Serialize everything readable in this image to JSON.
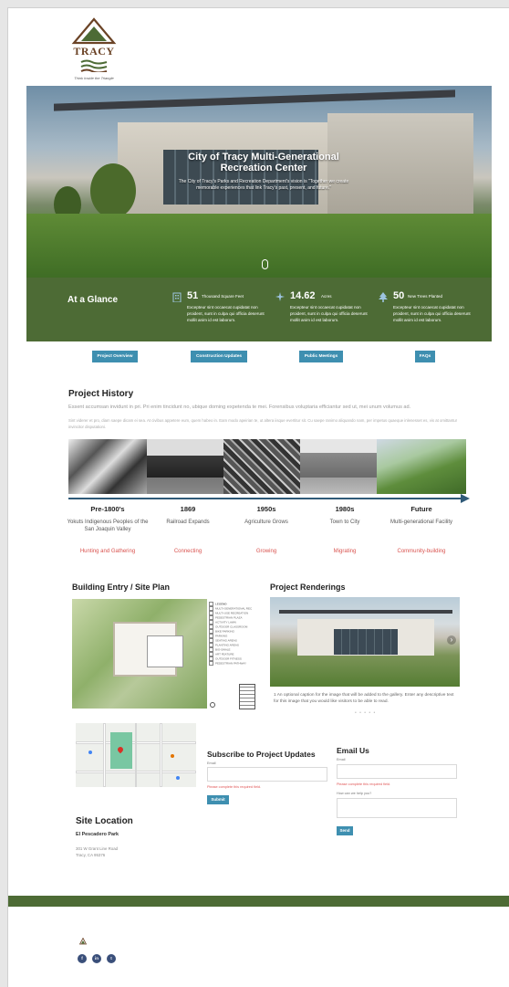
{
  "header": {
    "logo_text": "TRACY",
    "logo_tagline": "Think Inside the Triangle"
  },
  "hero": {
    "title": "City of Tracy Multi-Generational Recreation Center",
    "subtitle": "The City of Tracy's Parks and Recreation Department's vision is \"Together we create memorable experiences that link Tracy's past, present, and future.\""
  },
  "glance": {
    "title": "At a Glance",
    "stats": [
      {
        "number": "51",
        "unit": "Thousand Square Feet",
        "icon": "building-icon",
        "description": "Excepteur sint occaecat cupidatat non proident, sunt in culpa qui officia deserunt mollit anim id est laborum."
      },
      {
        "number": "14.62",
        "unit": "Acres",
        "icon": "compass-icon",
        "description": "Excepteur sint occaecat cupidatat non proident, sunt in culpa qui officia deserunt mollit anim id est laborum."
      },
      {
        "number": "50",
        "unit": "New Trees Planted",
        "icon": "tree-icon",
        "description": "Excepteur sint occaecat cupidatat non proident, sunt in culpa qui officia deserunt mollit anim id est laborum."
      }
    ]
  },
  "tabs": [
    "Project Overview",
    "Construction Updates",
    "Public Meetings",
    "FAQs"
  ],
  "history": {
    "title": "Project History",
    "lead": "Essent accumsan invidunt in pri. Pri enim tincidunt no, ubique doming expetenda te mei. Forensibus voluptaria efficiantur sed ut, mei unum volumus ad.",
    "body": "Sint viderer et pro, diam saepe dicam ei sea. At civibus appetere eum, quem habeo in. Eam modo apeirian te, ut altera iisque evertitur sit. Cu saepe ranimo aliquando nam, per impetus quaeque inlenesset es, vis at omittantur invincitor disputationi.",
    "eras": [
      {
        "year": "Pre-1800's",
        "caption": "Yokuts Indigenous Peoples of the San Joaquin Valley",
        "tag": "Hunting and Gathering"
      },
      {
        "year": "1869",
        "caption": "Railroad Expands",
        "tag": "Connecting"
      },
      {
        "year": "1950s",
        "caption": "Agriculture Grows",
        "tag": "Growing"
      },
      {
        "year": "1980s",
        "caption": "Town to City",
        "tag": "Migrating"
      },
      {
        "year": "Future",
        "caption": "Multi-generational Facility",
        "tag": "Community-building"
      }
    ]
  },
  "site_plan": {
    "title": "Building Entry / Site Plan",
    "legend_title": "LEGEND",
    "legend": [
      "MULTI-GENERATIONAL REC",
      "MULTI-USE RECREATION",
      "PEDESTRIAN PLAZA",
      "ACTIVITY LAWN",
      "OUTDOOR CLASSROOM",
      "BIKE PARKING",
      "PARKING",
      "SEATING AREAS",
      "PLANTING AREAS",
      "BIO-SWALE",
      "ART FEATURE",
      "OUTDOOR FITNESS",
      "PEDESTRIAN PATHWAY"
    ]
  },
  "renderings": {
    "title": "Project Renderings",
    "caption": "1 An optional caption for the image that will be added to the gallery. Enter any descriptive text for this image that you would like visitors to be able to read.",
    "dots": "• • • • •"
  },
  "site": {
    "title": "Site Location",
    "name": "El Pescadero Park",
    "address_line1": "301 W Grant Line Road",
    "address_line2": "Tracy, CA 95376"
  },
  "subscribe": {
    "title": "Subscribe to Project Updates",
    "email_label": "Email",
    "error": "Please complete this required field.",
    "button": "Submit"
  },
  "email_us": {
    "title": "Email Us",
    "email_label": "Email",
    "error": "Please complete this required field.",
    "message_label": "How can we help you?",
    "button": "Send"
  },
  "footer": {
    "social": [
      "f",
      "in",
      "t"
    ]
  },
  "colors": {
    "green": "#4d6b35",
    "blue": "#3e8fb0",
    "red": "#d9534f"
  }
}
